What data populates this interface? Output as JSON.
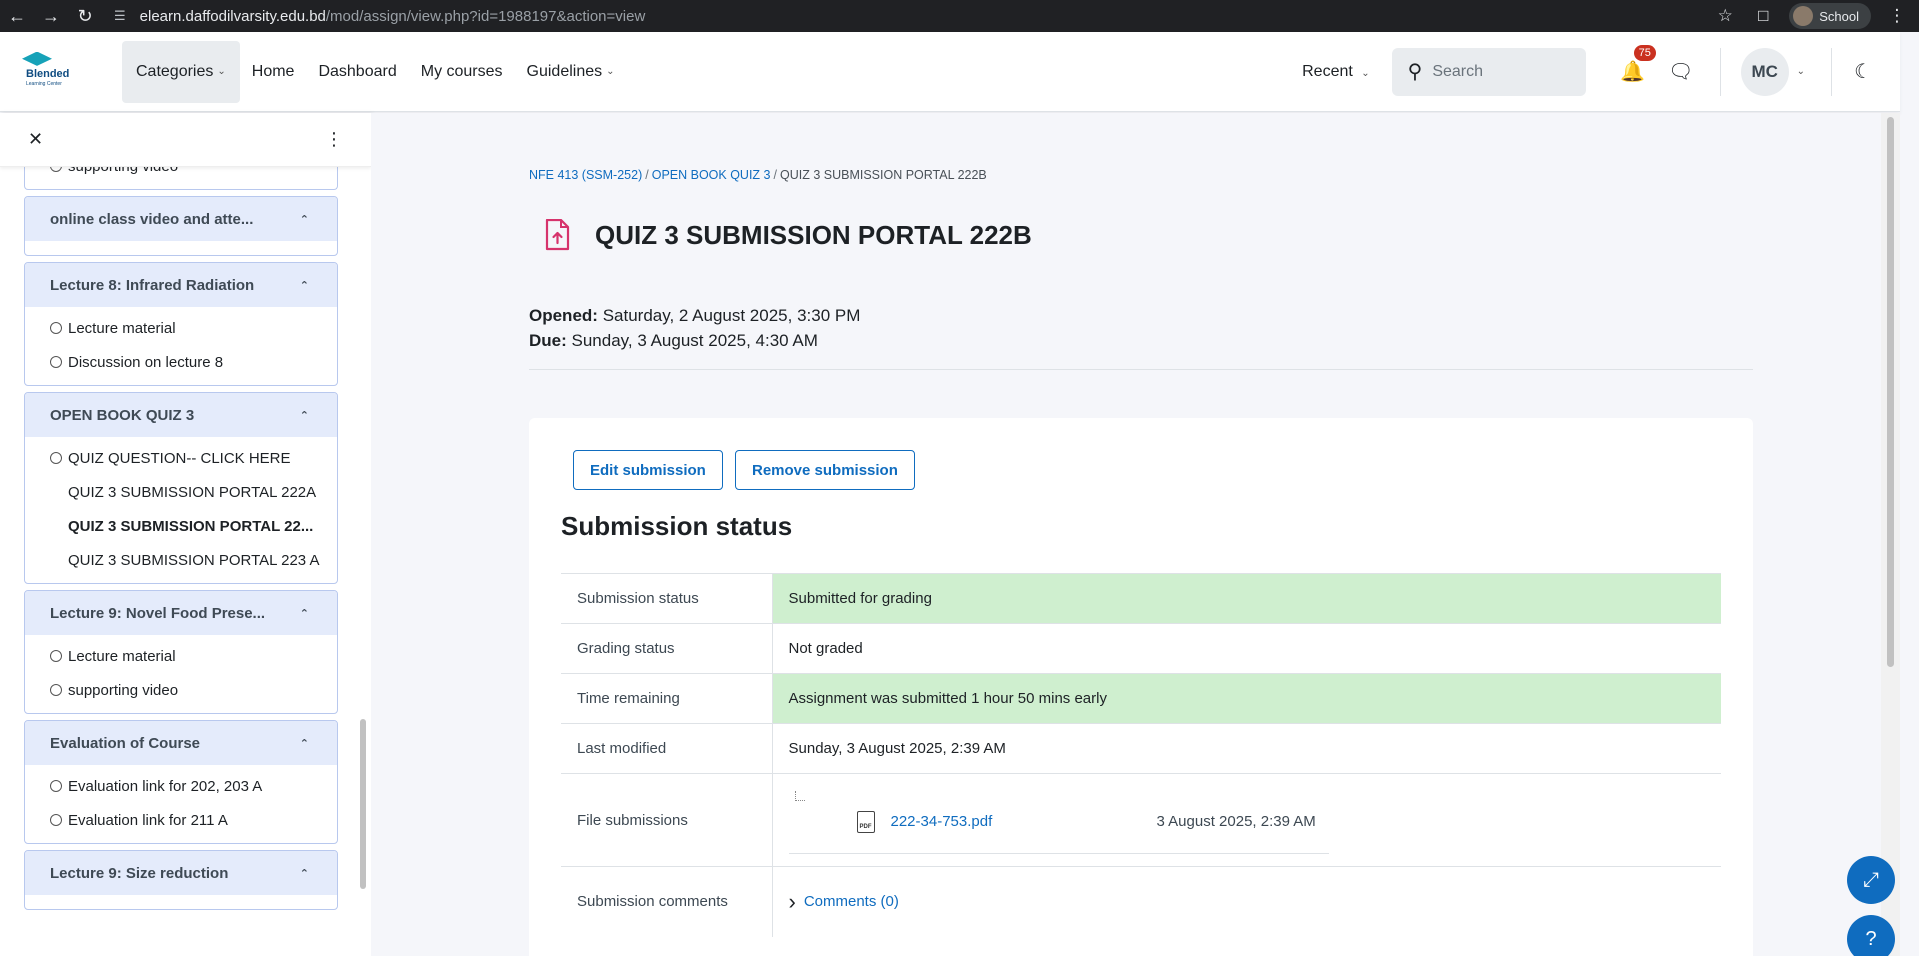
{
  "browser": {
    "url_domain": "elearn.daffodilvarsity.edu.bd",
    "url_path": "/mod/assign/view.php?id=1988197&action=view",
    "profile_label": "School"
  },
  "navbar": {
    "logo_text": "Blended",
    "logo_sub": "Learning Center",
    "items": [
      {
        "label": "Categories"
      },
      {
        "label": "Home"
      },
      {
        "label": "Dashboard"
      },
      {
        "label": "My courses"
      },
      {
        "label": "Guidelines"
      }
    ],
    "recent_label": "Recent",
    "search_placeholder": "Search",
    "notification_count": "75",
    "avatar_initials": "MC"
  },
  "drawer": {
    "sections": [
      {
        "title": "",
        "items": [
          {
            "label": "supporting video",
            "type": "circle"
          }
        ]
      },
      {
        "title": "online class video and atte...",
        "items": []
      },
      {
        "title": "Lecture 8: Infrared Radiation",
        "items": [
          {
            "label": "Lecture material",
            "type": "circle"
          },
          {
            "label": "Discussion on lecture 8",
            "type": "circle"
          }
        ]
      },
      {
        "title": "OPEN BOOK QUIZ 3",
        "items": [
          {
            "label": "QUIZ QUESTION-- CLICK HERE",
            "type": "circle"
          },
          {
            "label": "QUIZ 3 SUBMISSION PORTAL 222A",
            "type": "sub"
          },
          {
            "label": "QUIZ 3 SUBMISSION PORTAL 22...",
            "type": "sub-bold"
          },
          {
            "label": "QUIZ 3 SUBMISSION PORTAL 223 A",
            "type": "sub"
          }
        ]
      },
      {
        "title": "Lecture 9: Novel Food Prese...",
        "items": [
          {
            "label": "Lecture material",
            "type": "circle"
          },
          {
            "label": "supporting video",
            "type": "circle"
          }
        ]
      },
      {
        "title": "Evaluation of Course",
        "items": [
          {
            "label": "Evaluation link for 202, 203 A",
            "type": "circle"
          },
          {
            "label": "Evaluation link for 211 A",
            "type": "circle"
          }
        ]
      },
      {
        "title": "Lecture 9: Size reduction",
        "items": []
      }
    ]
  },
  "breadcrumb": {
    "course": "NFE 413 (SSM-252)",
    "section": "OPEN BOOK QUIZ 3",
    "current": "QUIZ 3 SUBMISSION PORTAL 222B"
  },
  "page": {
    "title": "QUIZ 3 SUBMISSION PORTAL 222B",
    "opened_label": "Opened:",
    "opened_value": "Saturday, 2 August 2025, 3:30 PM",
    "due_label": "Due:",
    "due_value": "Sunday, 3 August 2025, 4:30 AM"
  },
  "actions": {
    "edit": "Edit submission",
    "remove": "Remove submission"
  },
  "status": {
    "heading": "Submission status",
    "rows": [
      {
        "label": "Submission status",
        "value": "Submitted for grading"
      },
      {
        "label": "Grading status",
        "value": "Not graded"
      },
      {
        "label": "Time remaining",
        "value": "Assignment was submitted 1 hour 50 mins early"
      },
      {
        "label": "Last modified",
        "value": "Sunday, 3 August 2025, 2:39 AM"
      },
      {
        "label": "File submissions",
        "file_name": "222-34-753.pdf",
        "file_date": "3 August 2025, 2:39 AM"
      },
      {
        "label": "Submission comments",
        "value": "Comments (0)"
      }
    ]
  },
  "colors": {
    "accent": "#0f6cbf",
    "success_bg": "#cfefcf",
    "badge": "#ca3120"
  }
}
